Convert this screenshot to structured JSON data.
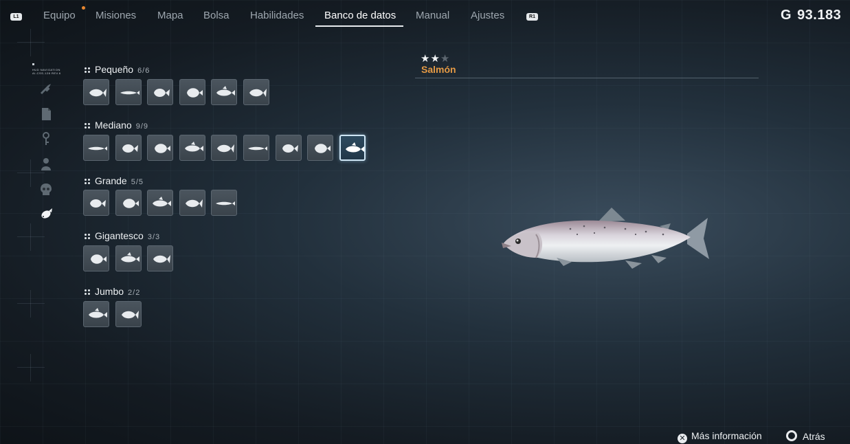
{
  "nav": {
    "left_bumper": "L1",
    "right_bumper": "R1",
    "tabs": [
      "Equipo",
      "Misiones",
      "Mapa",
      "Bolsa",
      "Habilidades",
      "Banco de datos",
      "Manual",
      "Ajustes"
    ],
    "active_tab": "Banco de datos",
    "currency_symbol": "G",
    "currency_value": "93.183"
  },
  "sidebar": {
    "hud_tag_line1": "HUD NAVIGATION",
    "hud_tag_line2": "AI-CSS-128 REV.6",
    "icons": [
      "weapon-icon",
      "document-icon",
      "key-icon",
      "person-icon",
      "skull-icon",
      "fish-icon"
    ],
    "active_icon": "fish-icon"
  },
  "categories": [
    {
      "name": "Pequeño",
      "count": "6/6",
      "slots": 6
    },
    {
      "name": "Mediano",
      "count": "9/9",
      "slots": 9,
      "selected_index": 8
    },
    {
      "name": "Grande",
      "count": "5/5",
      "slots": 5
    },
    {
      "name": "Gigantesco",
      "count": "3/3",
      "slots": 3
    },
    {
      "name": "Jumbo",
      "count": "2/2",
      "slots": 2
    }
  ],
  "detail": {
    "stars_filled": 2,
    "stars_total": 3,
    "stars_on": "★★",
    "stars_off": "★",
    "name": "Salmón"
  },
  "prompts": {
    "more_info": "Más información",
    "back": "Atrás"
  },
  "colors": {
    "accent_name": "#e59a45",
    "selected_border": "#cfe6f5"
  }
}
